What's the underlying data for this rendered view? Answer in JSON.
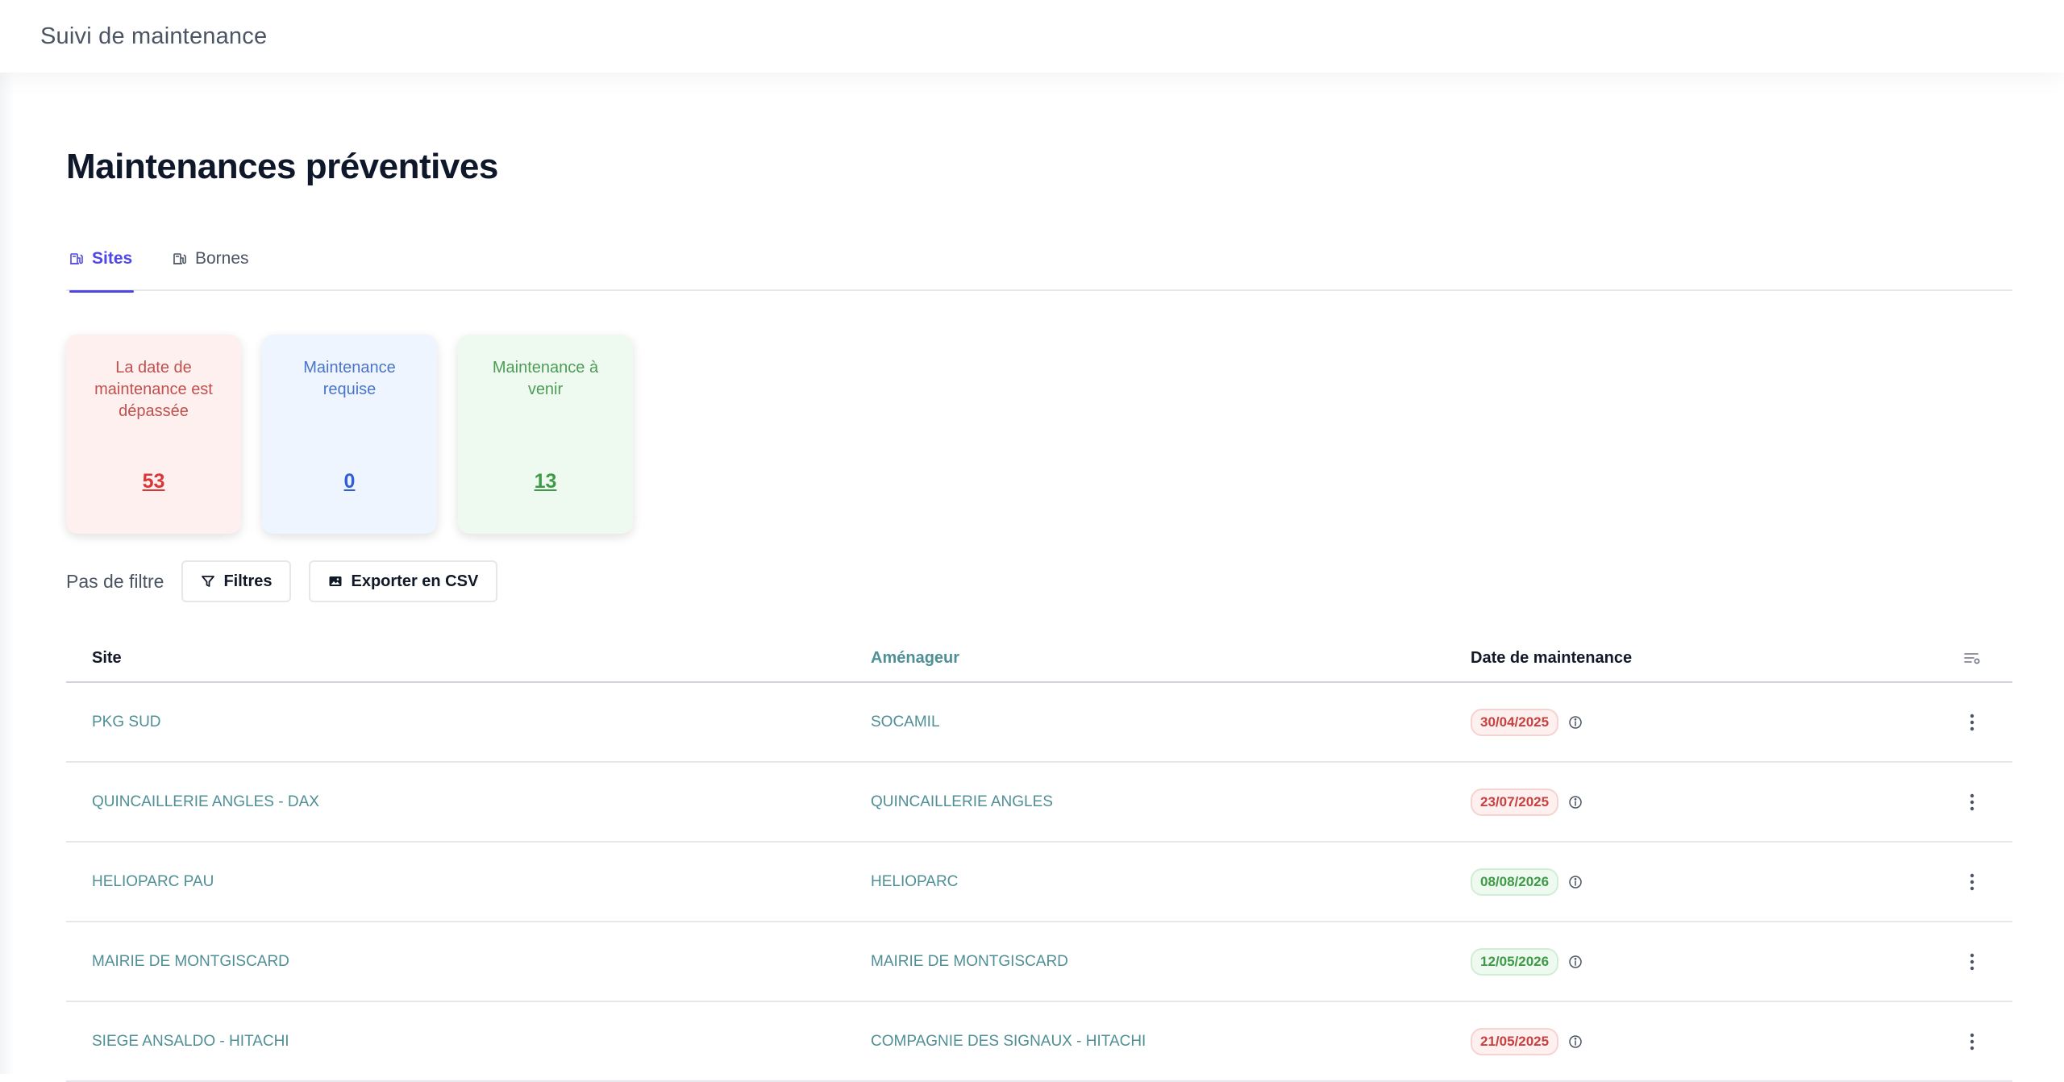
{
  "app": {
    "title": "Suivi de maintenance"
  },
  "page": {
    "title": "Maintenances préventives"
  },
  "tabs": [
    {
      "label": "Sites",
      "active": true,
      "icon": "station-icon"
    },
    {
      "label": "Bornes",
      "active": false,
      "icon": "station-icon"
    }
  ],
  "cards": [
    {
      "label": "La date de maintenance est dépassée",
      "count": "53",
      "color": "#d93636"
    },
    {
      "label": "Maintenance requise",
      "count": "0",
      "color": "#2f5ed6"
    },
    {
      "label": "Maintenance à venir",
      "count": "13",
      "color": "#3f9a48"
    }
  ],
  "filters": {
    "status": "Pas de filtre",
    "filter_label": "Filtres",
    "export_label": "Exporter en CSV"
  },
  "table": {
    "columns": [
      "Site",
      "Aménageur",
      "Date de maintenance"
    ],
    "rows": [
      {
        "site": "PKG SUD",
        "amenageur": "SOCAMIL",
        "date": "30/04/2025",
        "status": "overdue"
      },
      {
        "site": "QUINCAILLERIE ANGLES - DAX",
        "amenageur": "QUINCAILLERIE ANGLES",
        "date": "23/07/2025",
        "status": "overdue"
      },
      {
        "site": "HELIOPARC PAU",
        "amenageur": "HELIOPARC",
        "date": "08/08/2026",
        "status": "upcoming"
      },
      {
        "site": "MAIRIE DE MONTGISCARD",
        "amenageur": "MAIRIE DE MONTGISCARD",
        "date": "12/05/2026",
        "status": "upcoming"
      },
      {
        "site": "SIEGE ANSALDO - HITACHI",
        "amenageur": "COMPAGNIE DES SIGNAUX - HITACHI",
        "date": "21/05/2025",
        "status": "overdue"
      }
    ]
  },
  "colors": {
    "accent": "#4f46e5",
    "link": "#4f8f96",
    "overdue": "#c84040",
    "upcoming": "#3f9a48"
  }
}
